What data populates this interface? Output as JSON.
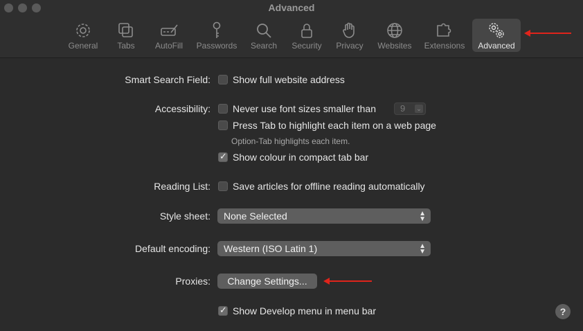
{
  "window": {
    "title": "Advanced"
  },
  "toolbar": {
    "items": [
      {
        "label": "General",
        "icon": "gear-icon"
      },
      {
        "label": "Tabs",
        "icon": "tabs-icon"
      },
      {
        "label": "AutoFill",
        "icon": "autofill-icon"
      },
      {
        "label": "Passwords",
        "icon": "key-icon"
      },
      {
        "label": "Search",
        "icon": "search-icon"
      },
      {
        "label": "Security",
        "icon": "lock-icon"
      },
      {
        "label": "Privacy",
        "icon": "hand-icon"
      },
      {
        "label": "Websites",
        "icon": "globe-icon"
      },
      {
        "label": "Extensions",
        "icon": "puzzle-icon"
      },
      {
        "label": "Advanced",
        "icon": "gears-icon"
      }
    ],
    "selected": "Advanced"
  },
  "settings": {
    "smart_search": {
      "label": "Smart Search Field:",
      "option": "Show full website address",
      "checked": false
    },
    "accessibility": {
      "label": "Accessibility:",
      "font_size_option": "Never use font sizes smaller than",
      "font_size_value": "9",
      "tab_option": "Press Tab to highlight each item on a web page",
      "tab_hint": "Option-Tab highlights each item.",
      "colour_option": "Show colour in compact tab bar",
      "colour_checked": true
    },
    "reading_list": {
      "label": "Reading List:",
      "option": "Save articles for offline reading automatically",
      "checked": false
    },
    "style_sheet": {
      "label": "Style sheet:",
      "value": "None Selected"
    },
    "default_encoding": {
      "label": "Default encoding:",
      "value": "Western (ISO Latin 1)"
    },
    "proxies": {
      "label": "Proxies:",
      "button": "Change Settings..."
    },
    "develop": {
      "option": "Show Develop menu in menu bar",
      "checked": true
    }
  },
  "help": {
    "label": "?"
  },
  "colors": {
    "annotation_arrow": "#e0241b",
    "background": "#2b2b2b"
  }
}
